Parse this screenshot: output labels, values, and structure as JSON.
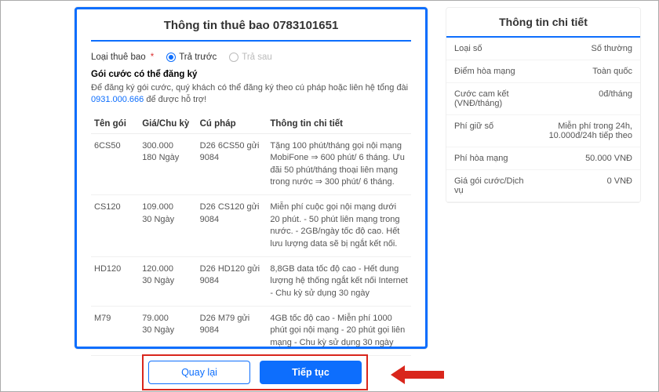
{
  "main": {
    "title": "Thông tin thuê bao 0783101651",
    "subscription_label": "Loại thuê bao",
    "required_mark": "*",
    "radio_prepaid": "Trả trước",
    "radio_postpaid": "Trả sau",
    "plan_heading": "Gói cước có thể đăng ký",
    "plan_subtext_prefix": "Để đăng ký gói cước, quý khách có thể đăng ký theo cú pháp hoặc liên hệ tổng đài ",
    "hotline": "0931.000.666",
    "plan_subtext_suffix": " để được hỗ trợ!",
    "table": {
      "headers": [
        "Tên gói",
        "Giá/Chu kỳ",
        "Cú pháp",
        "Thông tin chi tiết"
      ],
      "rows": [
        {
          "name": "6CS50",
          "price": "300.000\n180 Ngày",
          "syntax": "D26 6CS50 gửi 9084",
          "detail": "Tặng 100 phút/tháng gọi nội mạng MobiFone ⇒ 600 phút/ 6 tháng. Ưu đãi 50 phút/tháng thoại liên mạng trong nước ⇒ 300 phút/ 6 tháng."
        },
        {
          "name": "CS120",
          "price": "109.000\n30 Ngày",
          "syntax": "D26 CS120 gửi 9084",
          "detail": "Miễn phí cuộc gọi nội mạng dưới 20 phút. - 50 phút liên mạng trong nước. - 2GB/ngày tốc độ cao. Hết lưu lượng data sẽ bị ngắt kết nối."
        },
        {
          "name": "HD120",
          "price": "120.000\n30 Ngày",
          "syntax": "D26 HD120 gửi 9084",
          "detail": "8,8GB data tốc độ cao - Hết dung lượng hệ thống ngắt kết nối Internet - Chu kỳ sử dụng 30 ngày"
        },
        {
          "name": "M79",
          "price": "79.000\n30 Ngày",
          "syntax": "D26 M79 gửi 9084",
          "detail": "4GB tốc độ cao - Miễn phí 1000 phút gọi nội mạng - 20 phút gọi liên mạng - Chu kỳ sử dụng 30 ngày"
        }
      ]
    }
  },
  "side": {
    "title": "Thông tin chi tiết",
    "rows": [
      {
        "label": "Loại số",
        "value": "Số thường"
      },
      {
        "label": "Điểm hòa mạng",
        "value": "Toàn quốc"
      },
      {
        "label": "Cước cam kết (VNĐ/tháng)",
        "value": "0đ/tháng"
      },
      {
        "label": "Phí giữ số",
        "value": "Miễn phí trong 24h, 10.000đ/24h tiếp theo"
      },
      {
        "label": "Phí hòa mạng",
        "value": "50.000 VNĐ"
      },
      {
        "label": "Giá gói cước/Dịch vụ",
        "value": "0 VNĐ"
      }
    ]
  },
  "buttons": {
    "back": "Quay lại",
    "next": "Tiếp tục"
  }
}
